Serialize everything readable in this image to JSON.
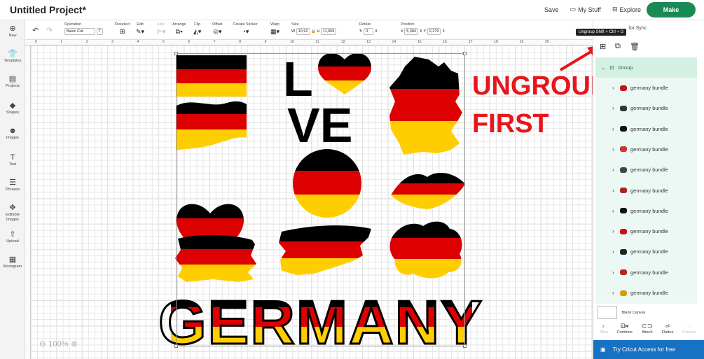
{
  "app": {
    "project_title": "Untitled Project*"
  },
  "top_actions": {
    "save": "Save",
    "my_stuff": "My Stuff",
    "explore": "Explore",
    "make": "Make"
  },
  "left_nav": [
    {
      "icon": "plus-icon",
      "glyph": "⊕",
      "label": "New"
    },
    {
      "icon": "templates-icon",
      "glyph": "👕",
      "label": "Templates"
    },
    {
      "icon": "projects-icon",
      "glyph": "▤",
      "label": "Projects"
    },
    {
      "icon": "shapes-icon",
      "glyph": "◆",
      "label": "Shapes"
    },
    {
      "icon": "images-icon",
      "glyph": "☻",
      "label": "Images"
    },
    {
      "icon": "text-icon",
      "glyph": "T",
      "label": "Text"
    },
    {
      "icon": "phrases-icon",
      "glyph": "☰",
      "label": "Phrases"
    },
    {
      "icon": "editable-images-icon",
      "glyph": "✥",
      "label": "Editable Images"
    },
    {
      "icon": "upload-icon",
      "glyph": "⇧",
      "label": "Upload"
    },
    {
      "icon": "monogram-icon",
      "glyph": "▦",
      "label": "Monogram"
    }
  ],
  "toolbar": {
    "operation_label": "Operation",
    "operation_value": "Basic Cut",
    "deselect": "Deselect",
    "edit": "Edit",
    "align": "Align",
    "arrange": "Arrange",
    "flip": "Flip",
    "offset": "Offset",
    "create_sticker": "Create Sticker",
    "warp": "Warp",
    "size_label": "Size",
    "w_label": "W",
    "w_value": "10,92",
    "h_label": "H",
    "h_value": "11,069",
    "rotate_label": "Rotate",
    "rotate_value": "0",
    "position_label": "Position",
    "x_label": "X",
    "x_value": "5,384",
    "y_label": "Y",
    "y_value": "0,279"
  },
  "ruler_marks": [
    "0",
    "1",
    "2",
    "3",
    "4",
    "5",
    "6",
    "7",
    "8",
    "9",
    "10",
    "11",
    "12",
    "13",
    "14",
    "15",
    "16",
    "17",
    "18",
    "19",
    "20"
  ],
  "zoom": {
    "value": "100%"
  },
  "annotation": {
    "line1": "UNGROUP",
    "line2": "FIRST"
  },
  "tooltip": "Ungroup Shift + Ctrl + G",
  "panel": {
    "color_sync": "lor Sync",
    "group_label": "Group",
    "layers": [
      {
        "name": "germany bundle",
        "thumb": "#c11"
      },
      {
        "name": "germany bundle",
        "thumb": "#333"
      },
      {
        "name": "germany bundle",
        "thumb": "#111"
      },
      {
        "name": "germany bundle",
        "thumb": "#c33"
      },
      {
        "name": "germany bundle",
        "thumb": "#444"
      },
      {
        "name": "germany bundle",
        "thumb": "#a22"
      },
      {
        "name": "germany bundle",
        "thumb": "#111"
      },
      {
        "name": "germany bundle",
        "thumb": "#c11"
      },
      {
        "name": "germany bundle",
        "thumb": "#222"
      },
      {
        "name": "germany bundle",
        "thumb": "#b22"
      },
      {
        "name": "germany bundle",
        "thumb": "#d4a000"
      }
    ],
    "blank_canvas": "Blank Canvas",
    "bottom_tools": [
      "Slice",
      "Combine",
      "Attach",
      "Flatten",
      "Contour"
    ],
    "access_cta": "Try Cricut Access for free"
  },
  "design_text": {
    "love_l": "L",
    "love_ve": "VE",
    "germany": "GERMANY"
  },
  "colors": {
    "black": "#000000",
    "red": "#dd0000",
    "gold": "#ffce00",
    "make_green": "#1a8a55",
    "access_blue": "#1872c4",
    "annot_red": "#e8151b"
  }
}
